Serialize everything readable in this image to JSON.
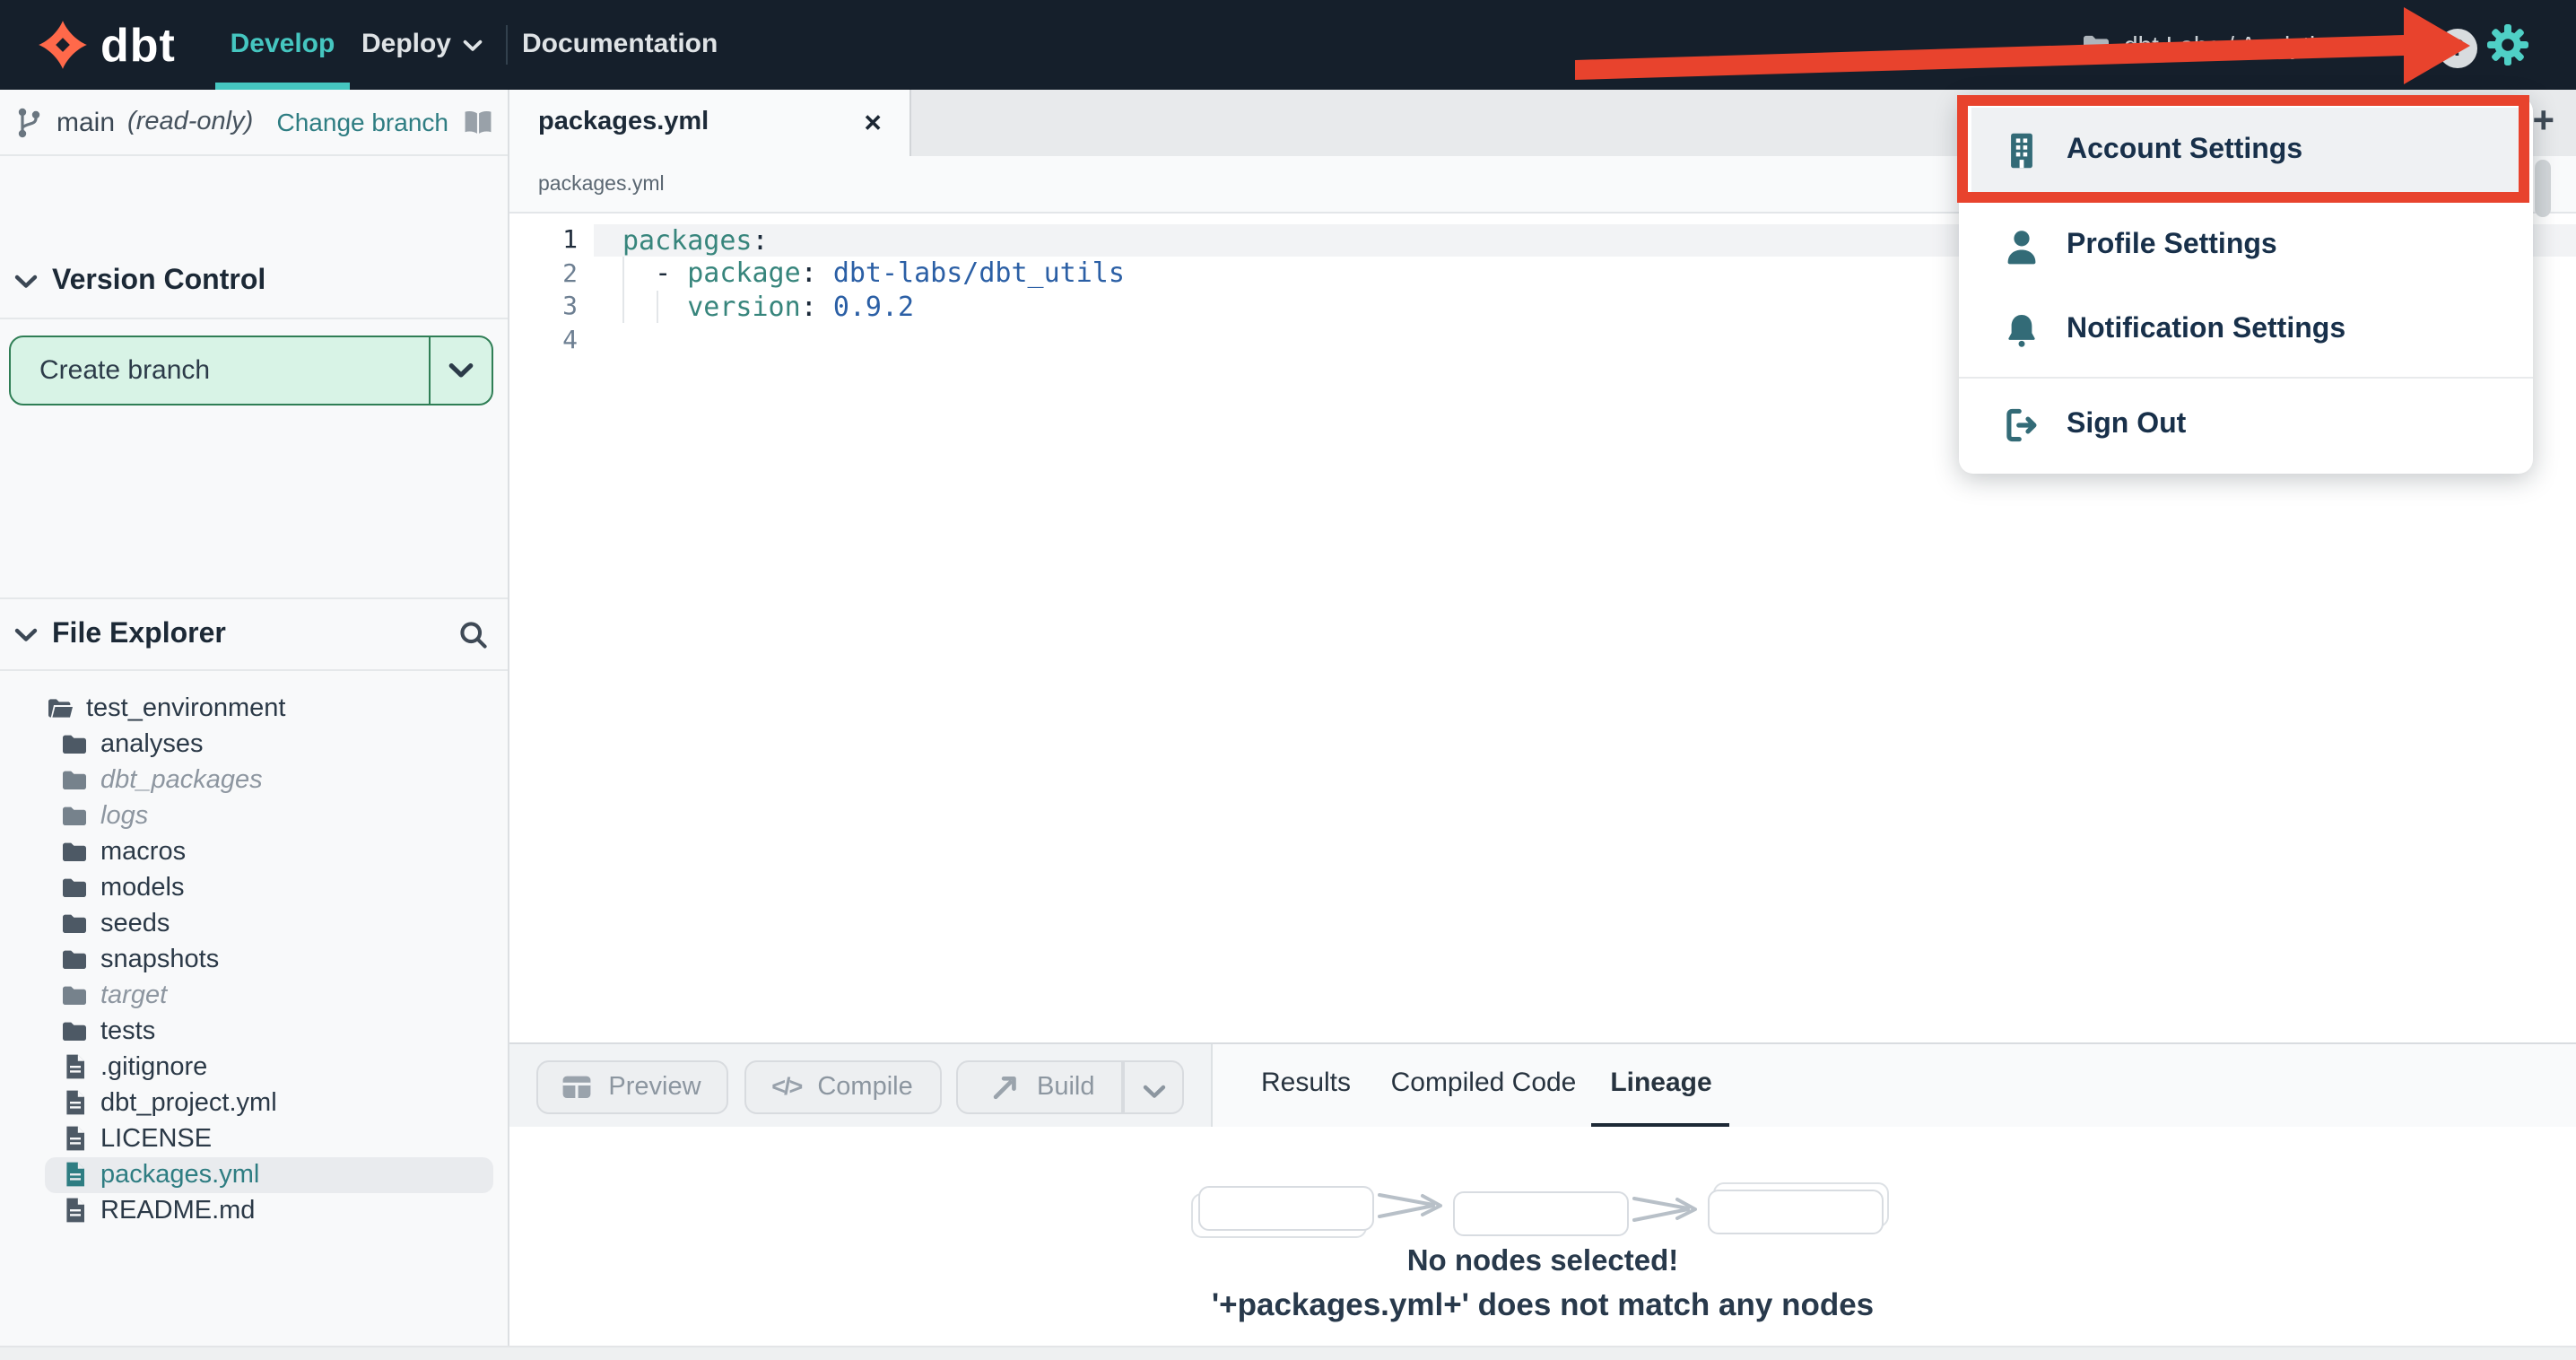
{
  "navbar": {
    "brand": "dbt",
    "nav": [
      {
        "label": "Develop",
        "active": true
      },
      {
        "label": "Deploy",
        "active": false
      },
      {
        "label": "Documentation",
        "active": false
      }
    ],
    "account_label": "dbt Labs / Analytics",
    "help_label": "?"
  },
  "menu": {
    "items": [
      {
        "label": "Account Settings",
        "icon": "building-icon",
        "highlighted": true
      },
      {
        "label": "Profile Settings",
        "icon": "person-icon"
      },
      {
        "label": "Notification Settings",
        "icon": "bell-icon"
      },
      {
        "label": "Sign Out",
        "icon": "sign-out-icon"
      }
    ]
  },
  "sidebar": {
    "branch": {
      "name": "main",
      "mode": "(read-only)",
      "change_label": "Change branch"
    },
    "version_control": {
      "title": "Version Control",
      "create_branch_label": "Create branch"
    },
    "file_explorer": {
      "title": "File Explorer",
      "tree": [
        {
          "label": "test_environment",
          "type": "folder-open",
          "depth": 0
        },
        {
          "label": "analyses",
          "type": "folder",
          "depth": 1
        },
        {
          "label": "dbt_packages",
          "type": "folder",
          "depth": 1,
          "italic": true
        },
        {
          "label": "logs",
          "type": "folder",
          "depth": 1,
          "italic": true
        },
        {
          "label": "macros",
          "type": "folder",
          "depth": 1
        },
        {
          "label": "models",
          "type": "folder",
          "depth": 1
        },
        {
          "label": "seeds",
          "type": "folder",
          "depth": 1
        },
        {
          "label": "snapshots",
          "type": "folder",
          "depth": 1
        },
        {
          "label": "target",
          "type": "folder",
          "depth": 1,
          "italic": true
        },
        {
          "label": "tests",
          "type": "folder",
          "depth": 1
        },
        {
          "label": ".gitignore",
          "type": "file",
          "depth": 1
        },
        {
          "label": "dbt_project.yml",
          "type": "file",
          "depth": 1
        },
        {
          "label": "LICENSE",
          "type": "file",
          "depth": 1
        },
        {
          "label": "packages.yml",
          "type": "file",
          "depth": 1,
          "selected": true
        },
        {
          "label": "README.md",
          "type": "file",
          "depth": 1
        }
      ]
    }
  },
  "editor": {
    "tab_label": "packages.yml",
    "breadcrumb": "packages.yml",
    "lines": [
      {
        "num": "1",
        "segments": {
          "key": "packages",
          "punct": ":"
        }
      },
      {
        "num": "2",
        "segments": {
          "lead": "  - ",
          "key": "package",
          "punct": ": ",
          "value": "dbt-labs/dbt_utils"
        }
      },
      {
        "num": "3",
        "segments": {
          "lead": "    ",
          "key": "version",
          "punct": ": ",
          "value": "0.9.2"
        }
      },
      {
        "num": "4",
        "segments": {}
      }
    ]
  },
  "actions": {
    "preview": "Preview",
    "compile": "Compile",
    "build": "Build"
  },
  "results_panel": {
    "tabs": [
      "Results",
      "Compiled Code",
      "Lineage"
    ],
    "active_tab": "Lineage"
  },
  "lineage": {
    "empty_title": "No nodes selected!",
    "empty_subtitle": "'+packages.yml+' does not match any nodes"
  },
  "icons": {
    "close": "✕",
    "plus": "+",
    "compile_glyph": "</>"
  },
  "colors": {
    "navbar_bg": "#151f2b",
    "accent_teal": "#45c6c0",
    "gear_teal": "#4fd0c6",
    "annotation_red": "#e8432d",
    "menu_icon_teal": "#336b77",
    "link_teal": "#2e7d82",
    "create_branch_bg": "#d8f3e6",
    "create_branch_border": "#2f7e55",
    "code_key": "#37857c",
    "code_value": "#2b5fa5"
  }
}
